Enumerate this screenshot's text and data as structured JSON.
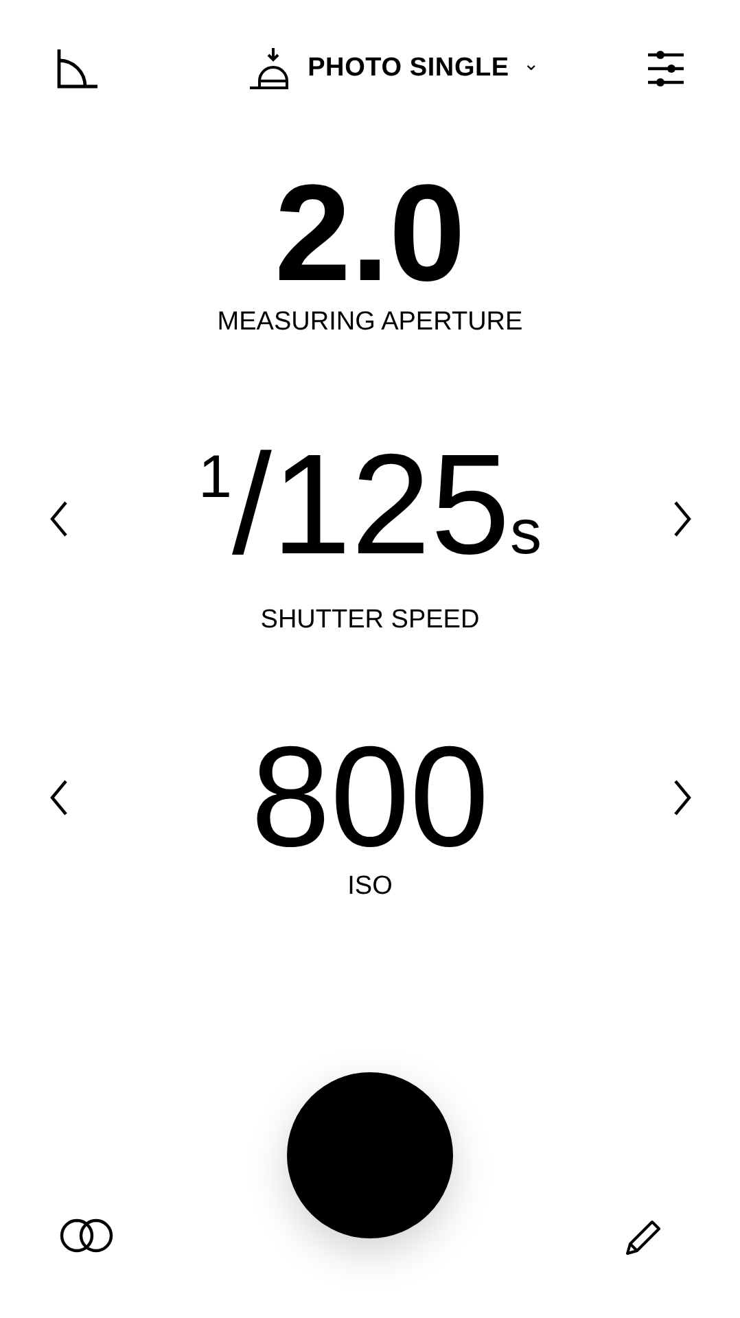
{
  "header": {
    "mode": "PHOTO SINGLE",
    "dropdown": "⌄"
  },
  "readings": [
    {
      "kind": "aperture",
      "value": "2.0",
      "label": "MEASURING APERTURE",
      "arrows": false
    },
    {
      "kind": "fraction",
      "prefix": "1",
      "value": "/125",
      "unit": "s",
      "label": "SHUTTER SPEED",
      "arrows": true
    },
    {
      "kind": "plain",
      "value": "800",
      "label": "ISO",
      "arrows": true
    }
  ]
}
